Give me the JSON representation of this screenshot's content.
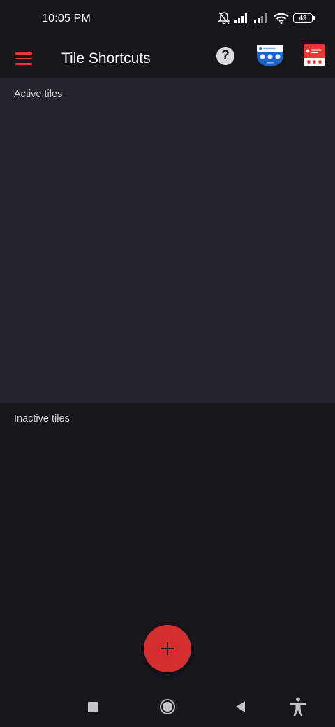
{
  "status_bar": {
    "time": "10:05 PM",
    "battery_level": "49",
    "icons": [
      "bell-off-icon",
      "signal-icon",
      "signal-icon",
      "wifi-icon",
      "battery-icon"
    ]
  },
  "app_bar": {
    "title": "Tile Shortcuts",
    "menu_icon": "hamburger-menu-icon",
    "help_label": "?",
    "accent_color": "#e53935"
  },
  "sections": {
    "active_title": "Active tiles",
    "inactive_title": "Inactive tiles"
  },
  "fab": {
    "icon": "plus-icon",
    "color": "#d32f2f"
  },
  "nav_bar": {
    "icons": [
      "recents-square-icon",
      "home-circle-icon",
      "back-triangle-icon",
      "accessibility-icon"
    ]
  }
}
